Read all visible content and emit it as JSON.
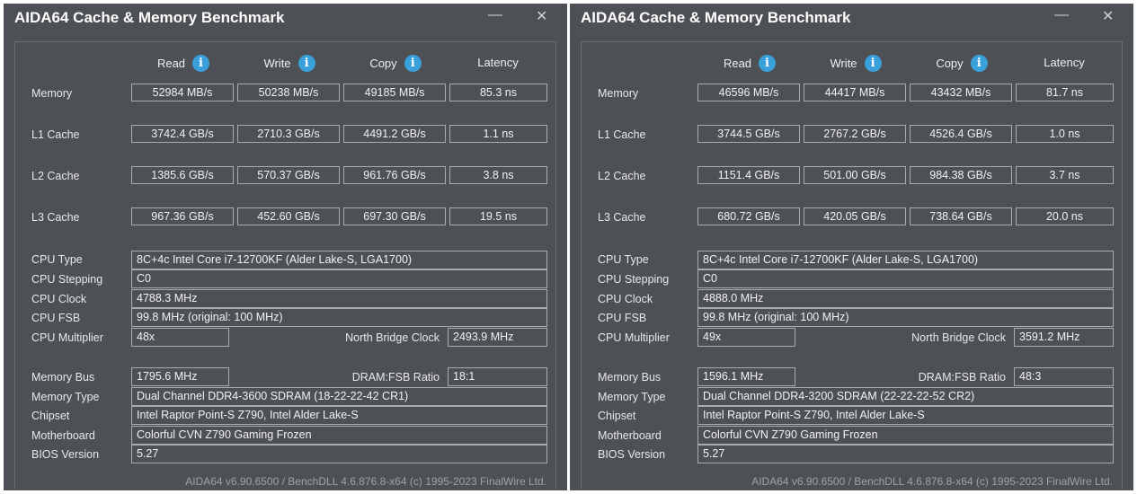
{
  "windows": [
    {
      "title": "AIDA64 Cache & Memory Benchmark",
      "controls": {
        "minimize": "—",
        "close": "✕"
      },
      "headers": {
        "read": "Read",
        "write": "Write",
        "copy": "Copy",
        "latency": "Latency"
      },
      "rows": [
        {
          "label": "Memory",
          "read": "52984 MB/s",
          "write": "50238 MB/s",
          "copy": "49185 MB/s",
          "latency": "85.3 ns"
        },
        {
          "label": "L1 Cache",
          "read": "3742.4 GB/s",
          "write": "2710.3 GB/s",
          "copy": "4491.2 GB/s",
          "latency": "1.1 ns"
        },
        {
          "label": "L2 Cache",
          "read": "1385.6 GB/s",
          "write": "570.37 GB/s",
          "copy": "961.76 GB/s",
          "latency": "3.8 ns"
        },
        {
          "label": "L3 Cache",
          "read": "967.36 GB/s",
          "write": "452.60 GB/s",
          "copy": "697.30 GB/s",
          "latency": "19.5 ns"
        }
      ],
      "info": {
        "cpu_type": {
          "label": "CPU Type",
          "value": "8C+4c Intel Core i7-12700KF  (Alder Lake-S, LGA1700)"
        },
        "cpu_stepping": {
          "label": "CPU Stepping",
          "value": "C0"
        },
        "cpu_clock": {
          "label": "CPU Clock",
          "value": "4788.3 MHz"
        },
        "cpu_fsb": {
          "label": "CPU FSB",
          "value": "99.8 MHz  (original: 100 MHz)"
        },
        "cpu_multiplier": {
          "label": "CPU Multiplier",
          "value": "48x"
        },
        "nb_clock": {
          "label": "North Bridge Clock",
          "value": "2493.9 MHz"
        },
        "memory_bus": {
          "label": "Memory Bus",
          "value": "1795.6 MHz"
        },
        "dram_ratio": {
          "label": "DRAM:FSB Ratio",
          "value": "18:1"
        },
        "memory_type": {
          "label": "Memory Type",
          "value": "Dual Channel DDR4-3600 SDRAM  (18-22-22-42 CR1)"
        },
        "chipset": {
          "label": "Chipset",
          "value": "Intel Raptor Point-S Z790, Intel Alder Lake-S"
        },
        "motherboard": {
          "label": "Motherboard",
          "value": "Colorful CVN Z790 Gaming Frozen"
        },
        "bios": {
          "label": "BIOS Version",
          "value": "5.27"
        }
      },
      "footer": "AIDA64 v6.90.6500 / BenchDLL 4.6.876.8-x64  (c) 1995-2023 FinalWire Ltd."
    },
    {
      "title": "AIDA64 Cache & Memory Benchmark",
      "controls": {
        "minimize": "—",
        "close": "✕"
      },
      "headers": {
        "read": "Read",
        "write": "Write",
        "copy": "Copy",
        "latency": "Latency"
      },
      "rows": [
        {
          "label": "Memory",
          "read": "46596 MB/s",
          "write": "44417 MB/s",
          "copy": "43432 MB/s",
          "latency": "81.7 ns"
        },
        {
          "label": "L1 Cache",
          "read": "3744.5 GB/s",
          "write": "2767.2 GB/s",
          "copy": "4526.4 GB/s",
          "latency": "1.0 ns"
        },
        {
          "label": "L2 Cache",
          "read": "1151.4 GB/s",
          "write": "501.00 GB/s",
          "copy": "984.38 GB/s",
          "latency": "3.7 ns"
        },
        {
          "label": "L3 Cache",
          "read": "680.72 GB/s",
          "write": "420.05 GB/s",
          "copy": "738.64 GB/s",
          "latency": "20.0 ns"
        }
      ],
      "info": {
        "cpu_type": {
          "label": "CPU Type",
          "value": "8C+4c Intel Core i7-12700KF  (Alder Lake-S, LGA1700)"
        },
        "cpu_stepping": {
          "label": "CPU Stepping",
          "value": "C0"
        },
        "cpu_clock": {
          "label": "CPU Clock",
          "value": "4888.0 MHz"
        },
        "cpu_fsb": {
          "label": "CPU FSB",
          "value": "99.8 MHz  (original: 100 MHz)"
        },
        "cpu_multiplier": {
          "label": "CPU Multiplier",
          "value": "49x"
        },
        "nb_clock": {
          "label": "North Bridge Clock",
          "value": "3591.2 MHz"
        },
        "memory_bus": {
          "label": "Memory Bus",
          "value": "1596.1 MHz"
        },
        "dram_ratio": {
          "label": "DRAM:FSB Ratio",
          "value": "48:3"
        },
        "memory_type": {
          "label": "Memory Type",
          "value": "Dual Channel DDR4-3200 SDRAM  (22-22-22-52 CR2)"
        },
        "chipset": {
          "label": "Chipset",
          "value": "Intel Raptor Point-S Z790, Intel Alder Lake-S"
        },
        "motherboard": {
          "label": "Motherboard",
          "value": "Colorful CVN Z790 Gaming Frozen"
        },
        "bios": {
          "label": "BIOS Version",
          "value": "5.27"
        }
      },
      "footer": "AIDA64 v6.90.6500 / BenchDLL 4.6.876.8-x64  (c) 1995-2023 FinalWire Ltd."
    }
  ],
  "icons": {
    "info": "info-icon",
    "minimize": "minimize-icon",
    "close": "close-icon"
  },
  "colors": {
    "window_bg": "#4d5054",
    "info_icon": "#3aa0dc",
    "border": "#a9abae",
    "footer_text": "#9fa2a5"
  }
}
